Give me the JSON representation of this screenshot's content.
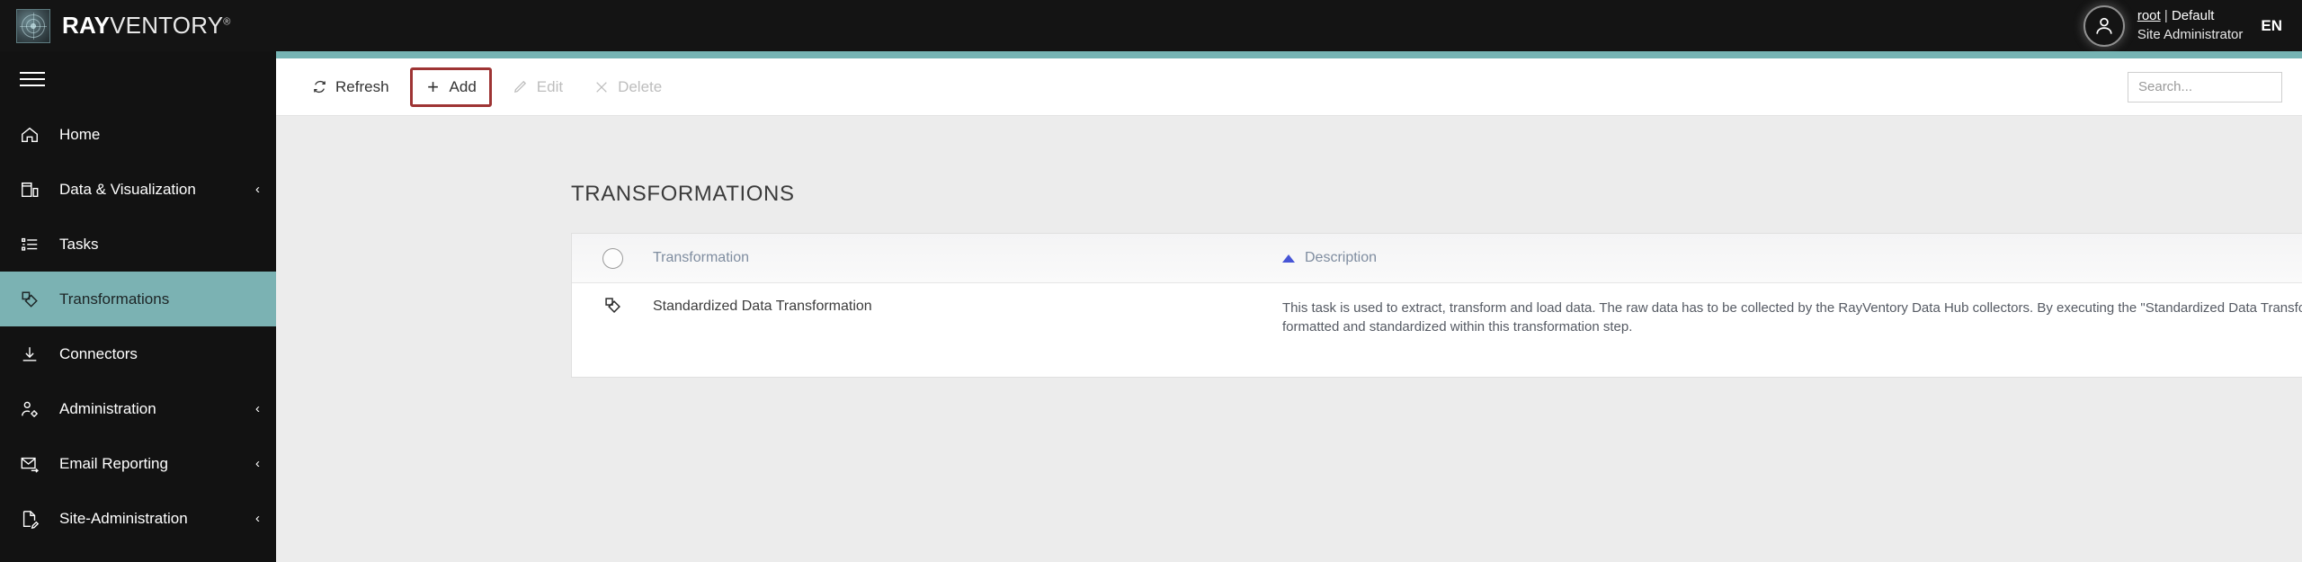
{
  "header": {
    "logo": {
      "bold_part": "RAY",
      "thin_part": "VENTORY",
      "trademark": "®",
      "icon": "radar-logo-icon"
    },
    "user": {
      "name": "root",
      "separator": "|",
      "tenant": "Default",
      "role": "Site Administrator",
      "avatar_icon": "user-avatar-icon"
    },
    "language": "EN"
  },
  "sidebar": {
    "menu_icon": "hamburger-menu-icon",
    "items": [
      {
        "label": "Home",
        "icon": "home-icon",
        "has_chevron": false,
        "active": false
      },
      {
        "label": "Data & Visualization",
        "icon": "dashboard-icon",
        "has_chevron": true,
        "active": false
      },
      {
        "label": "Tasks",
        "icon": "task-list-icon",
        "has_chevron": false,
        "active": false
      },
      {
        "label": "Transformations",
        "icon": "transformation-icon",
        "has_chevron": false,
        "active": true
      },
      {
        "label": "Connectors",
        "icon": "download-arrow-icon",
        "has_chevron": false,
        "active": false
      },
      {
        "label": "Administration",
        "icon": "user-gear-icon",
        "has_chevron": true,
        "active": false
      },
      {
        "label": "Email Reporting",
        "icon": "email-send-icon",
        "has_chevron": true,
        "active": false
      },
      {
        "label": "Site-Administration",
        "icon": "document-edit-icon",
        "has_chevron": true,
        "active": false
      }
    ],
    "chevron_glyph": "‹"
  },
  "toolbar": {
    "refresh_label": "Refresh",
    "add_label": "Add",
    "edit_label": "Edit",
    "delete_label": "Delete",
    "add_highlight_color": "#9e3434"
  },
  "search": {
    "placeholder": "Search...",
    "value": "",
    "icon": "search-icon"
  },
  "main": {
    "page_title": "TRANSFORMATIONS",
    "table": {
      "select_all_icon": "select-all-circle-icon",
      "column_settings_icon": "column-settings-icon",
      "sort_indicator": "sort-ascending-icon",
      "columns": [
        {
          "label": "Transformation",
          "sorted": false
        },
        {
          "label": "Description",
          "sorted": true,
          "direction": "ascending"
        }
      ],
      "rows": [
        {
          "icon": "transformation-icon",
          "name": "Standardized Data Transformation",
          "description": "This task is used to extract, transform and load data. The raw data has to be collected by the RayVentory Data Hub collectors. By executing the \"Standardized Data Transformation\" task, the data will be formatted and standardized within this transformation step."
        }
      ]
    }
  },
  "colors": {
    "accent_teal": "#76b4b4",
    "header_dark": "#141414",
    "sidebar_dark": "#121212",
    "sort_blue": "#4755d6",
    "highlight_red": "#9e3434"
  }
}
